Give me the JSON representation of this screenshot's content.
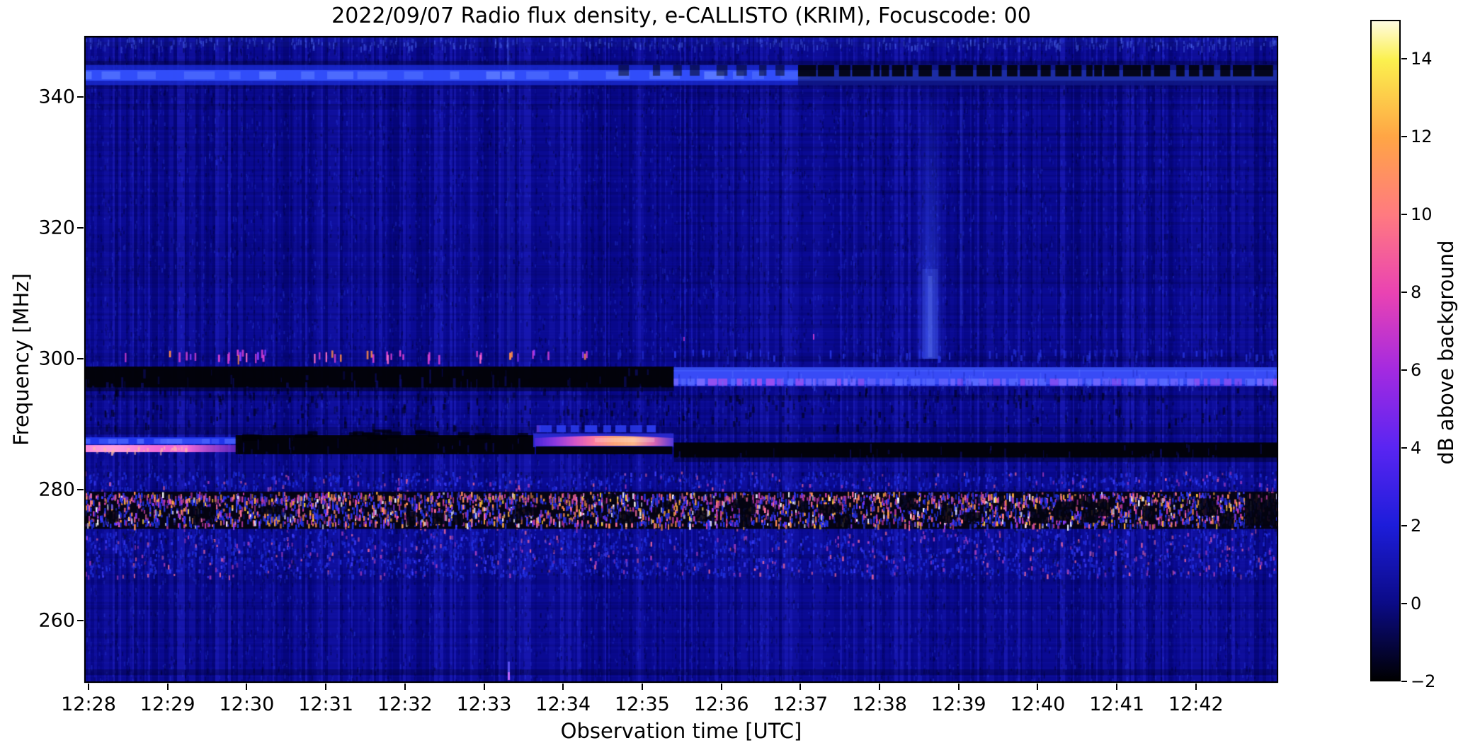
{
  "figure": {
    "title": "2022/09/07  Radio flux density, e-CALLISTO (KRIM), Focuscode: 00"
  },
  "axes": {
    "xlabel": "Observation time [UTC]",
    "ylabel": "Frequency [MHz]",
    "x_ticks": [
      "12:28",
      "12:29",
      "12:30",
      "12:31",
      "12:32",
      "12:33",
      "12:34",
      "12:35",
      "12:36",
      "12:37",
      "12:38",
      "12:39",
      "12:40",
      "12:41",
      "12:42"
    ],
    "y_ticks": [
      {
        "value": 340,
        "label": "340"
      },
      {
        "value": 320,
        "label": "320"
      },
      {
        "value": 300,
        "label": "300"
      },
      {
        "value": 280,
        "label": "280"
      },
      {
        "value": 260,
        "label": "260"
      }
    ]
  },
  "colorbar": {
    "label": "dB above background",
    "vmin": -2,
    "vmax": 15,
    "ticks": [
      {
        "value": 14,
        "label": "14"
      },
      {
        "value": 12,
        "label": "12"
      },
      {
        "value": 10,
        "label": "10"
      },
      {
        "value": 8,
        "label": "8"
      },
      {
        "value": 6,
        "label": "6"
      },
      {
        "value": 4,
        "label": "4"
      },
      {
        "value": 2,
        "label": "2"
      },
      {
        "value": 0,
        "label": "0"
      },
      {
        "value": -2,
        "label": "−2"
      }
    ],
    "stops": [
      {
        "v": -2,
        "color": "#000002"
      },
      {
        "v": 0,
        "color": "#0b0b88"
      },
      {
        "v": 2,
        "color": "#1d1dda"
      },
      {
        "v": 4,
        "color": "#5a25f2"
      },
      {
        "v": 6,
        "color": "#a42ae0"
      },
      {
        "v": 8,
        "color": "#ea43b2"
      },
      {
        "v": 10,
        "color": "#ff7a80"
      },
      {
        "v": 12,
        "color": "#ffa545"
      },
      {
        "v": 14,
        "color": "#fbf04e"
      },
      {
        "v": 15,
        "color": "#fffbe0"
      }
    ]
  },
  "chart_data": {
    "type": "heatmap",
    "title": "2022/09/07  Radio flux density, e-CALLISTO (KRIM), Focuscode: 00",
    "xlabel": "Observation time [UTC]",
    "ylabel": "Frequency [MHz]",
    "x_tick_labels": [
      "12:28",
      "12:29",
      "12:30",
      "12:31",
      "12:32",
      "12:33",
      "12:34",
      "12:35",
      "12:36",
      "12:37",
      "12:38",
      "12:39",
      "12:40",
      "12:41",
      "12:42"
    ],
    "y_tick_values": [
      340,
      320,
      300,
      280,
      260
    ],
    "time_unit": "minutes after 12:28 UTC",
    "time_range": [
      -0.05,
      15.05
    ],
    "freq_range_mhz": [
      250.4,
      349.3
    ],
    "value_range_db": [
      -2,
      15
    ],
    "background_level_db": 0.5,
    "colormap": "black-blue-violet-magenta-pink-orange-yellow-white",
    "features": [
      {
        "id": "rfi-band-343",
        "type": "h-band",
        "f": [
          341.8,
          344.9
        ],
        "t": [
          -0.05,
          15.05
        ],
        "db": 3.5,
        "note": "persistent bright-blue RFI stripe ~343 MHz, dims after 12:37"
      },
      {
        "id": "rfi-343-interference",
        "type": "dark-dashes",
        "f": [
          343.4,
          344.9
        ],
        "t": [
          6.7,
          15.05
        ],
        "t_dense": 9.0,
        "db": -2,
        "note": "black interference dashes over the 343 MHz stripe"
      },
      {
        "id": "tick-row-300",
        "type": "tick-row",
        "f": [
          299.8,
          301.4
        ],
        "t": [
          0.35,
          6.3
        ],
        "db": 7,
        "note": "sparse magenta/orange telemetry ticks near 300.5 MHz"
      },
      {
        "id": "dash-row-300-blue",
        "type": "tick-row-blue",
        "f": [
          299.9,
          301.3
        ],
        "t": [
          6.35,
          15.0
        ],
        "db": 3,
        "note": "faint blue tick row continuing to the right edge"
      },
      {
        "id": "quiet-297-left",
        "type": "black-band",
        "f": [
          295.6,
          298.8
        ],
        "t": [
          -0.05,
          7.4
        ],
        "db": -2,
        "note": "quiet (notched) channel band ~297 MHz"
      },
      {
        "id": "active-297-right",
        "type": "bright-band",
        "f": [
          295.8,
          298.7
        ],
        "t": [
          7.4,
          15.05
        ],
        "db": 4.5,
        "note": "channel switches on at ~12:35:25, bright blue-violet band"
      },
      {
        "id": "dash-row-290",
        "type": "blue-dashes",
        "f": [
          288.7,
          289.9
        ],
        "t": [
          5.7,
          7.2
        ],
        "db": 3.5,
        "note": "short bright-blue dashes above the burst"
      },
      {
        "id": "line-288-blue",
        "type": "line-blue",
        "f": [
          286.8,
          287.9
        ],
        "t": [
          -0.05,
          1.86
        ],
        "db": 4,
        "note": "blue carrier line"
      },
      {
        "id": "line-286-magenta",
        "type": "line-hot",
        "f": [
          285.6,
          286.8
        ],
        "t": [
          -0.05,
          1.86
        ],
        "db": 8,
        "note": "bright magenta-pink carrier, hottest near 12:28.2, fades by 12:29.9"
      },
      {
        "id": "quiet-287-mid",
        "type": "black-band",
        "f": [
          285.4,
          287.7
        ],
        "t": [
          1.86,
          5.64
        ],
        "db": -2,
        "note": "carrier off: black band"
      },
      {
        "id": "burst-287",
        "type": "streak",
        "f": [
          286.6,
          288.6
        ],
        "t": [
          5.64,
          7.38
        ],
        "db": 12,
        "note": "bright emission streak, blue rim with pink→salmon/orange core"
      },
      {
        "id": "quiet-287-right",
        "type": "black-band",
        "f": [
          284.9,
          287.2
        ],
        "t": [
          7.4,
          15.05
        ],
        "db": -2,
        "note": "black band to right edge after burst"
      },
      {
        "id": "noise-band-276",
        "type": "speckle-band",
        "f_outer": [
          266.8,
          282.8
        ],
        "f_core": [
          274.0,
          279.7
        ],
        "t": [
          -0.05,
          15.05
        ],
        "db": [
          -2,
          13
        ],
        "note": "broadband speckled RFI: black core with blue/magenta/pink/orange/yellow/white speckles"
      },
      {
        "id": "plume-1238",
        "type": "v-glow",
        "t": [
          10.47,
          10.81
        ],
        "f": [
          300,
          343
        ],
        "db": 2,
        "note": "faint light-blue vertical plume near 12:38.6"
      },
      {
        "id": "vline-1233",
        "type": "v-line",
        "t": [
          5.3,
          5.34
        ],
        "f": [
          250.4,
          349.3
        ],
        "db": 2,
        "note": "thin vertical artifact at ~12:33.3, bright violet tip at bottom"
      },
      {
        "id": "vline-1239",
        "type": "v-line-faint",
        "t": [
          11.02,
          11.06
        ],
        "f": [
          305,
          340
        ],
        "db": 1.5,
        "note": "second faint vertical line near 12:39.0"
      }
    ]
  },
  "palette": {
    "bg_base": "#0a0a92",
    "bg_dark": "#06067a",
    "bg_light": "#1717b0",
    "black": "#020206",
    "band343_base": "#1a2bd0",
    "band343_core": "#3452ff",
    "band343_bright": "#5d7dff",
    "tick_magenta": "#d23ed2",
    "tick_orange": "#ff8c4a",
    "tick_violet": "#8a3bff",
    "tick_pink": "#ff6ec8",
    "tick_blue": "#2c3cf0",
    "b297_base": "#2030da",
    "b297_core": "#3b4ffa",
    "b297_hot": "#7b6bff",
    "b297_magenta": "#a050f0",
    "left_blue": "#2238f0",
    "left_blue_hi": "#4f6aff",
    "left_magenta": "#f06ad8",
    "left_magenta_hi": "#ff9ede",
    "left_salmon": "#ffb8a8",
    "left_fade": "#8c35d8",
    "streak_stops": [
      "#4a28d8",
      "#8c3ae0",
      "#d455c8",
      "#ff7ea0",
      "#ffa678",
      "#ffb888",
      "#e06ab0",
      "#5a3ad8"
    ],
    "noise_colors": [
      "#2030e0",
      "#3a3aff",
      "#101060",
      "#c23aa8",
      "#ff6f9e",
      "#ff8d55",
      "#ffae3f",
      "#ffd43c",
      "#8a3bff",
      "#ffffff"
    ],
    "plume": "#3c54ff",
    "vline": "#5a78ff",
    "vline_tip": "#cc6aff"
  }
}
